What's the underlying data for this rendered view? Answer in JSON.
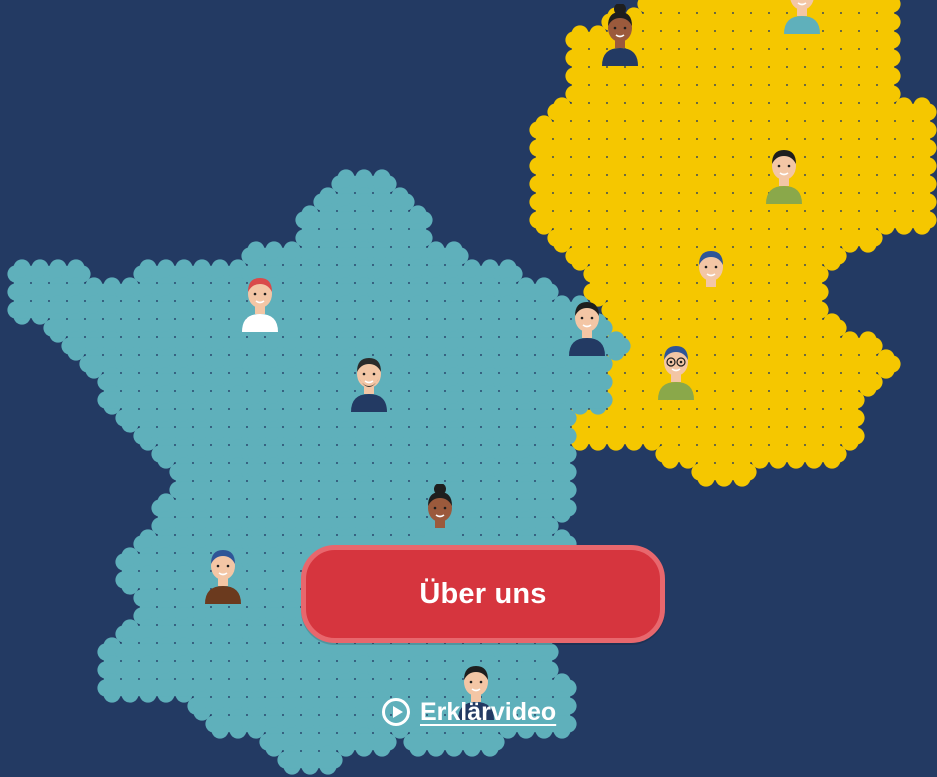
{
  "colors": {
    "background": "#233a63",
    "france_fill": "#5fb0bb",
    "germany_fill": "#f5c700",
    "button_fill": "#d6353e",
    "button_border": "#e8676d",
    "link_text": "#ffffff"
  },
  "hero": {
    "map_regions": [
      {
        "name": "france",
        "color": "#5fb0bb"
      },
      {
        "name": "germany",
        "color": "#f5c700"
      }
    ],
    "people": [
      {
        "id": "person-red-hair",
        "hair": "#d94a4a",
        "skin": "#f3c6a5",
        "shirt": "#ffffff"
      },
      {
        "id": "person-bald-beard",
        "hair": "#2b2b2b",
        "skin": "#f3c6a5",
        "shirt": "#233a63"
      },
      {
        "id": "person-bun-dark-skin",
        "hair": "#1e1e1e",
        "skin": "#9b5a3c",
        "shirt": "#5fb0bb"
      },
      {
        "id": "person-blue-cap",
        "hair": "#2f5597",
        "skin": "#f3c6a5",
        "shirt": "#6b3a1e"
      },
      {
        "id": "person-dark-hair-bottom",
        "hair": "#1e1e1e",
        "skin": "#f3c6a5",
        "shirt": "#233a63"
      },
      {
        "id": "person-border",
        "hair": "#1e1e1e",
        "skin": "#f3c6a5",
        "shirt": "#233a63"
      },
      {
        "id": "person-top-bun",
        "hair": "#1e1e1e",
        "skin": "#9b5a3c",
        "shirt": "#233a63"
      },
      {
        "id": "person-top-right",
        "hair": "#1e1e1e",
        "skin": "#f3c6a5",
        "shirt": "#5fb0bb"
      },
      {
        "id": "person-green-shirt",
        "hair": "#1e1e1e",
        "skin": "#f3c6a5",
        "shirt": "#8aa84a"
      },
      {
        "id": "person-blue-hair",
        "hair": "#2f5597",
        "skin": "#f3c6a5",
        "shirt": "#f5c700"
      },
      {
        "id": "person-glasses",
        "hair": "#2f5597",
        "skin": "#f3c6a5",
        "shirt": "#8aa84a"
      }
    ]
  },
  "cta": {
    "label": "Über uns"
  },
  "video": {
    "label": "Erklärvideo",
    "icon": "play-circle-icon"
  }
}
